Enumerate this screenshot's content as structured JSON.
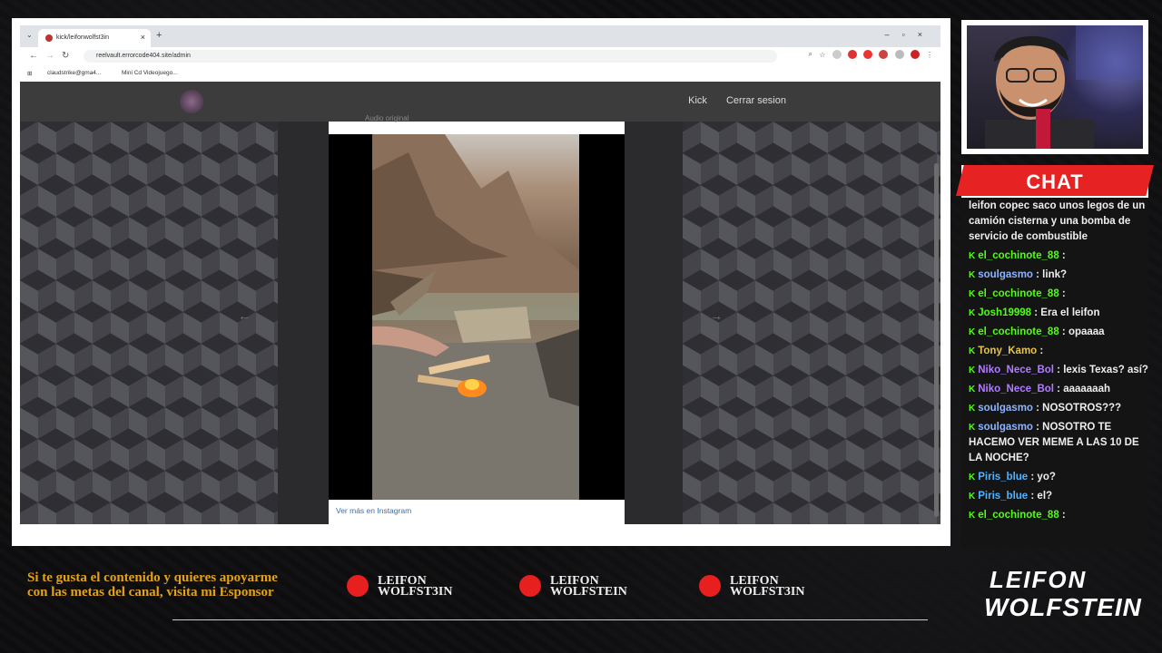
{
  "browser": {
    "tab_title": "kick/leifonwolfst3in",
    "url": "reelvault.errorcode404.site/admin",
    "bookmarks": [
      "claudstrike@gma4...",
      "Mini Cd Videojuego..."
    ]
  },
  "site": {
    "nav": [
      "Kick",
      "Cerrar sesion"
    ],
    "post_header": "Audio original",
    "instagram_link": "Ver más en Instagram"
  },
  "chat": {
    "title": "CHAT",
    "messages": [
      {
        "user": "",
        "text": "leifon copec saco unos legos de un camión cisterna y una bomba de servicio de combustible",
        "color": "#ffffff"
      },
      {
        "user": "el_cochinote_88",
        "text": ":",
        "color": "#53fc18"
      },
      {
        "user": "soulgasmo",
        "text": ": link?",
        "color": "#8db4ff"
      },
      {
        "user": "el_cochinote_88",
        "text": ":",
        "color": "#53fc18"
      },
      {
        "user": "Josh19998",
        "text": ": Era el leifon",
        "color": "#53fc18"
      },
      {
        "user": "el_cochinote_88",
        "text": ": opaaaa",
        "color": "#53fc18"
      },
      {
        "user": "Tony_Kamo",
        "text": ":",
        "color": "#e6c54a"
      },
      {
        "user": "Niko_Nece_Bol",
        "text": ": lexis Texas? así?",
        "color": "#b07cff"
      },
      {
        "user": "Niko_Nece_Bol",
        "text": ": aaaaaaah",
        "color": "#b07cff"
      },
      {
        "user": "soulgasmo",
        "text": ": NOSOTROS???",
        "color": "#8db4ff"
      },
      {
        "user": "soulgasmo",
        "text": ": NOSOTRO TE HACEMO VER MEME A LAS 10 DE LA NOCHE?",
        "color": "#8db4ff"
      },
      {
        "user": "Piris_blue",
        "text": ": yo?",
        "color": "#4fb3ff"
      },
      {
        "user": "Piris_blue",
        "text": ": el?",
        "color": "#4fb3ff"
      },
      {
        "user": "el_cochinote_88",
        "text": ":",
        "color": "#53fc18"
      }
    ]
  },
  "footer": {
    "sponsor_text": "Si te gusta el contenido y quieres apoyarme con las metas del canal, visita mi Esponsor",
    "socials": [
      {
        "icon": "youtube-icon",
        "label": "LEIFON WOLFST3IN"
      },
      {
        "icon": "instagram-icon",
        "label": "LEIFON WOLFSTEIN"
      },
      {
        "icon": "tiktok-icon",
        "label": "LEIFON WOLFST3IN"
      }
    ],
    "brand_line1": "LEIFON",
    "brand_line2": "WOLFSTEIN"
  }
}
